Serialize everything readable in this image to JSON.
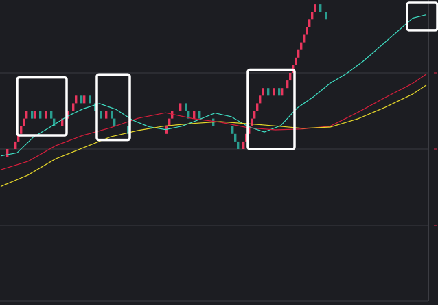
{
  "theme": {
    "background": "#1c1d22",
    "grid": "#3a3b41",
    "axis": "#5a5b62",
    "tick_mark": "#e0284a",
    "up": "#e8365d",
    "down": "#2a9d8f",
    "ma_fast": "#3fe0c5",
    "ma_mid": "#d81e3c",
    "ma_slow": "#e6d72a",
    "highlight_box": "#ffffff"
  },
  "chart_data": {
    "type": "renko",
    "title": "",
    "xlabel": "",
    "ylabel": "",
    "ylim": [
      0,
      100
    ],
    "brick_size": 2.5,
    "grid": "horizontal",
    "x": [
      0,
      1,
      2,
      3,
      4,
      5,
      6,
      7,
      8,
      9,
      10,
      11,
      12,
      13,
      14,
      15,
      16,
      17,
      18,
      19,
      20,
      21,
      22,
      23,
      24,
      25,
      26,
      27,
      28,
      29,
      30,
      31,
      32,
      33,
      34,
      35,
      36,
      37,
      38,
      39,
      40,
      41,
      42,
      43,
      44,
      45,
      46,
      47,
      48,
      49,
      50,
      51,
      52,
      53,
      54,
      55,
      56,
      57,
      58,
      59,
      60,
      61,
      62,
      63,
      64,
      65,
      66,
      67,
      68,
      69,
      70,
      71,
      72,
      73,
      74,
      75,
      76,
      77,
      78,
      79,
      80,
      81,
      82,
      83,
      84,
      85,
      86,
      87,
      88,
      89,
      90,
      91,
      92,
      93,
      94,
      95,
      96,
      97,
      98,
      99,
      100,
      101,
      102,
      103,
      104,
      105,
      106,
      107,
      108,
      109,
      110,
      111,
      112,
      113,
      114,
      115,
      116,
      117,
      118,
      119,
      120,
      121,
      122,
      123,
      124,
      125,
      126,
      127,
      128,
      129,
      130,
      131,
      132,
      133,
      134,
      135,
      136,
      137,
      138,
      139,
      140,
      141,
      142,
      143,
      144,
      145,
      146,
      147,
      148,
      149,
      150,
      151,
      152,
      153,
      154,
      155
    ],
    "series": [
      {
        "kind": "renko",
        "open": [
          47.5,
          47.5,
          47.5,
          50,
          50,
          50,
          52.5,
          55,
          57.5,
          60,
          62.5,
          62.5,
          60,
          62.5,
          62.5,
          60,
          60,
          62.5,
          62.5,
          60,
          57.5,
          57.5,
          57.5,
          60,
          60,
          62.5,
          62.5,
          65,
          67.5,
          67.5,
          65,
          67.5,
          67.5,
          65,
          65,
          62.5,
          62.5,
          60,
          60,
          62.5,
          62.5,
          60,
          57.5,
          57.5,
          57.5,
          57.5,
          57.5,
          55,
          55,
          55,
          55,
          55,
          55,
          55,
          55,
          55,
          55,
          55,
          55,
          55,
          55,
          57.5,
          60,
          62.5,
          62.5,
          62.5,
          65,
          65,
          62.5,
          60,
          60,
          62.5,
          62.5,
          60,
          60,
          60,
          60,
          60,
          57.5,
          57.5,
          57.5,
          57.5,
          57.5,
          57.5,
          57.5,
          55,
          52.5,
          50,
          50,
          52.5,
          55,
          57.5,
          60,
          62.5,
          65,
          67.5,
          70,
          70,
          67.5,
          67.5,
          70,
          70,
          67.5,
          70,
          70,
          72.5,
          75,
          77.5,
          80,
          82.5,
          85,
          87.5,
          90,
          92.5,
          95,
          97.5,
          97.5,
          95,
          95,
          92.5,
          92.5,
          92.5,
          92.5,
          92.5,
          92.5,
          92.5,
          92.5,
          92.5,
          92.5,
          92.5,
          92.5,
          92.5,
          92.5,
          92.5,
          92.5,
          92.5,
          92.5,
          92.5,
          92.5,
          92.5,
          92.5,
          92.5,
          92.5,
          92.5,
          92.5,
          92.5,
          92.5,
          92.5,
          92.5,
          92.5,
          92.5,
          92.5,
          92.5,
          92.5
        ],
        "close": [
          47.5,
          47.5,
          50,
          50,
          50,
          52.5,
          55,
          57.5,
          60,
          62.5,
          62.5,
          60,
          62.5,
          62.5,
          60,
          60,
          62.5,
          62.5,
          60,
          57.5,
          57.5,
          57.5,
          60,
          60,
          62.5,
          62.5,
          65,
          67.5,
          67.5,
          65,
          67.5,
          67.5,
          65,
          65,
          62.5,
          62.5,
          60,
          60,
          62.5,
          62.5,
          60,
          57.5,
          57.5,
          57.5,
          57.5,
          57.5,
          55,
          55,
          55,
          55,
          55,
          55,
          55,
          55,
          55,
          55,
          55,
          55,
          55,
          55,
          57.5,
          60,
          62.5,
          62.5,
          62.5,
          65,
          65,
          62.5,
          60,
          60,
          62.5,
          62.5,
          60,
          60,
          60,
          60,
          60,
          57.5,
          57.5,
          57.5,
          57.5,
          57.5,
          57.5,
          57.5,
          55,
          52.5,
          50,
          50,
          52.5,
          55,
          57.5,
          60,
          62.5,
          65,
          67.5,
          70,
          70,
          67.5,
          67.5,
          70,
          70,
          67.5,
          70,
          70,
          72.5,
          75,
          77.5,
          80,
          82.5,
          85,
          87.5,
          90,
          92.5,
          95,
          97.5,
          97.5,
          95,
          95,
          92.5,
          92.5,
          92.5,
          92.5,
          92.5,
          92.5,
          92.5,
          92.5,
          92.5,
          92.5,
          92.5,
          92.5,
          92.5,
          92.5,
          92.5,
          92.5,
          92.5,
          92.5,
          92.5,
          92.5,
          92.5,
          92.5,
          92.5,
          92.5,
          92.5,
          92.5,
          92.5,
          92.5,
          92.5,
          92.5,
          92.5,
          92.5,
          92.5,
          92.5,
          92.5,
          92.5
        ]
      }
    ],
    "moving_averages": [
      {
        "color_key": "ma_fast",
        "x": [
          0,
          6,
          12,
          18,
          24,
          30,
          36,
          42,
          48,
          54,
          60,
          66,
          72,
          78,
          84,
          90,
          96,
          102,
          108,
          114,
          120,
          126,
          132,
          138,
          144,
          150,
          155
        ],
        "y": [
          47.8,
          48.8,
          54.0,
          57.2,
          60.6,
          63.2,
          64.9,
          63.0,
          59.5,
          57.3,
          56.4,
          57.5,
          59.6,
          61.8,
          60.6,
          57.4,
          55.6,
          57.7,
          63.5,
          67.2,
          71.6,
          74.8,
          78.8,
          83.5,
          88.2,
          92.9,
          94.0
        ]
      },
      {
        "color_key": "ma_mid",
        "x": [
          0,
          10,
          20,
          30,
          40,
          50,
          60,
          70,
          80,
          90,
          100,
          110,
          120,
          130,
          140,
          150,
          155
        ],
        "y": [
          43.2,
          46.0,
          51.1,
          54.5,
          57.0,
          60.1,
          61.9,
          60.0,
          58.8,
          57.0,
          56.3,
          56.6,
          57.5,
          62.0,
          66.9,
          71.5,
          74.6
        ]
      },
      {
        "color_key": "ma_slow",
        "x": [
          0,
          10,
          20,
          30,
          40,
          50,
          60,
          70,
          80,
          90,
          100,
          110,
          120,
          130,
          140,
          150,
          155
        ],
        "y": [
          37.7,
          41.5,
          46.8,
          50.4,
          54.0,
          56.1,
          57.6,
          58.4,
          59.0,
          58.3,
          57.6,
          56.8,
          57.2,
          59.9,
          63.7,
          68.0,
          71.0
        ]
      }
    ],
    "highlight_boxes": [
      {
        "x_start": 6,
        "x_end": 24,
        "y_low": 54.5,
        "y_high": 73.5
      },
      {
        "x_start": 35,
        "x_end": 47,
        "y_low": 53.0,
        "y_high": 74.5
      },
      {
        "x_start": 90,
        "x_end": 107,
        "y_low": 50.0,
        "y_high": 76.0
      },
      {
        "x_start": 148,
        "x_end": 159,
        "y_low": 89.0,
        "y_high": 108.0
      }
    ]
  }
}
